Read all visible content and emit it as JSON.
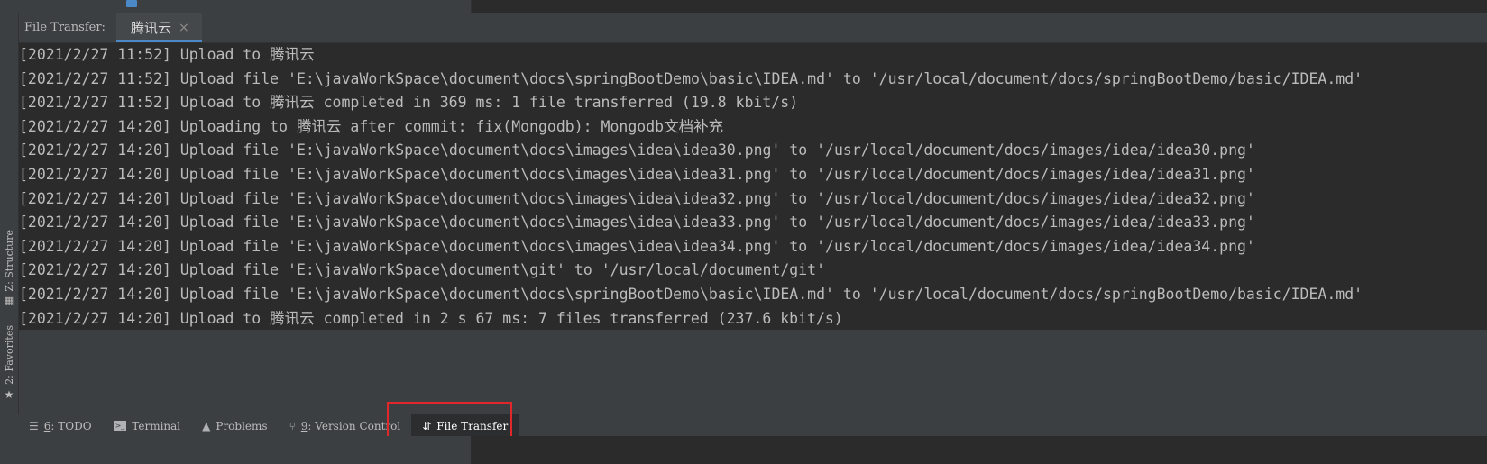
{
  "header": {
    "title": "File Transfer:",
    "tab_label": "腾讯云",
    "close_glyph": "×"
  },
  "console": {
    "lines": [
      "[2021/2/27 11:52] Upload to 腾讯云",
      "[2021/2/27 11:52] Upload file 'E:\\javaWorkSpace\\document\\docs\\springBootDemo\\basic\\IDEA.md' to '/usr/local/document/docs/springBootDemo/basic/IDEA.md'",
      "[2021/2/27 11:52] Upload to 腾讯云 completed in 369 ms: 1 file transferred (19.8 kbit/s)",
      "[2021/2/27 14:20] Uploading to 腾讯云 after commit: fix(Mongodb): Mongodb文档补充",
      "[2021/2/27 14:20] Upload file 'E:\\javaWorkSpace\\document\\docs\\images\\idea\\idea30.png' to '/usr/local/document/docs/images/idea/idea30.png'",
      "[2021/2/27 14:20] Upload file 'E:\\javaWorkSpace\\document\\docs\\images\\idea\\idea31.png' to '/usr/local/document/docs/images/idea/idea31.png'",
      "[2021/2/27 14:20] Upload file 'E:\\javaWorkSpace\\document\\docs\\images\\idea\\idea32.png' to '/usr/local/document/docs/images/idea/idea32.png'",
      "[2021/2/27 14:20] Upload file 'E:\\javaWorkSpace\\document\\docs\\images\\idea\\idea33.png' to '/usr/local/document/docs/images/idea/idea33.png'",
      "[2021/2/27 14:20] Upload file 'E:\\javaWorkSpace\\document\\docs\\images\\idea\\idea34.png' to '/usr/local/document/docs/images/idea/idea34.png'",
      "[2021/2/27 14:20] Upload file 'E:\\javaWorkSpace\\document\\git' to '/usr/local/document/git'",
      "[2021/2/27 14:20] Upload file 'E:\\javaWorkSpace\\document\\docs\\springBootDemo\\basic\\IDEA.md' to '/usr/local/document/docs/springBootDemo/basic/IDEA.md'",
      "[2021/2/27 14:20] Upload to 腾讯云 completed in 2 s 67 ms: 7 files transferred (237.6 kbit/s)"
    ]
  },
  "left_gutter": {
    "structure_label": "Z: Structure",
    "favorites_label": "2: Favorites"
  },
  "bottom_bar": {
    "todo": {
      "num": "6",
      "label": ": TODO",
      "icon": "list-icon"
    },
    "terminal": {
      "label": "Terminal",
      "icon": "terminal-icon"
    },
    "problems": {
      "label": "Problems",
      "icon": "warning-icon"
    },
    "version_control": {
      "num": "9",
      "label": ": Version Control",
      "icon": "branch-icon"
    },
    "file_transfer": {
      "label": "File Transfer",
      "icon": "transfer-arrows-icon"
    }
  },
  "colors": {
    "accent": "#4a88c7",
    "highlight": "#e0282a",
    "background": "#2b2b2b",
    "panel": "#3c3f41"
  }
}
